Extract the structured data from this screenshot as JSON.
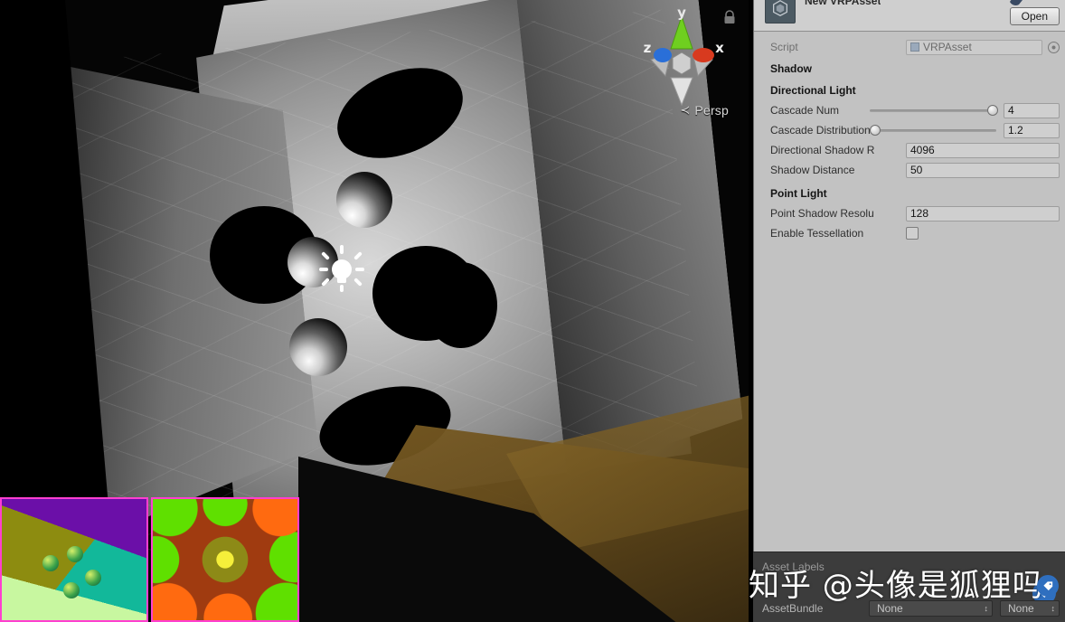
{
  "scene": {
    "gizmo": {
      "axis_x": "x",
      "axis_y": "y",
      "axis_z": "z",
      "x_color": "#d83a1f",
      "y_color": "#6fcf1f",
      "z_color": "#2a6fd8"
    },
    "projection_label": "Persp",
    "projection_caret": "≺",
    "lock_icon": "lock-icon",
    "light_gizmo_icon": "point-light-icon",
    "debug_thumbnails": [
      {
        "name": "debug-thumbnail-gbuffer",
        "border_color": "#ff3fd0"
      },
      {
        "name": "debug-thumbnail-lightmap",
        "border_color": "#ff3fd0"
      }
    ]
  },
  "inspector": {
    "title": "New VRPAsset",
    "unity_icon": "unity-logo-icon",
    "preset_icon": "preset-icon",
    "open_label": "Open",
    "script": {
      "label": "Script",
      "value": "VRPAsset",
      "icon": "script-file-icon",
      "selector_icon": "object-picker-icon"
    },
    "sections": [
      {
        "heading": "Shadow",
        "rows": []
      },
      {
        "heading": "Directional Light",
        "rows": [
          {
            "label": "Cascade Num",
            "type": "slider",
            "value": "4",
            "fill": 98
          },
          {
            "label": "Cascade Distribution",
            "type": "slider",
            "value": "1.2",
            "fill": 4
          },
          {
            "label": "Directional Shadow R",
            "type": "text",
            "value": "4096"
          },
          {
            "label": "Shadow Distance",
            "type": "text",
            "value": "50"
          }
        ]
      },
      {
        "heading": "Point Light",
        "rows": [
          {
            "label": "Point Shadow Resolu",
            "type": "text",
            "value": "128"
          },
          {
            "label": "Enable Tessellation",
            "type": "checkbox",
            "value": "",
            "checked": false
          }
        ]
      }
    ]
  },
  "asset_bar": {
    "labels_title": "Asset Labels",
    "tag_icon": "label-tag-icon",
    "assetbundle_label": "AssetBundle",
    "assetbundle_name": "None",
    "assetbundle_variant": "None",
    "dropdown_arrows": "↕"
  },
  "watermark": {
    "text": "知乎 @头像是狐狸吗",
    "badge_icon": "zhihu-tag-icon"
  }
}
